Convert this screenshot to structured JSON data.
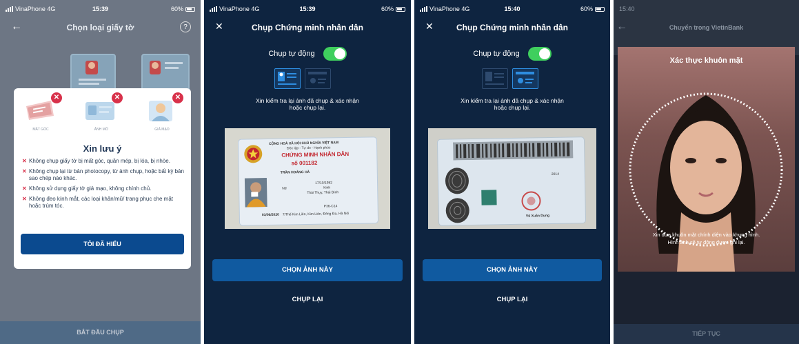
{
  "panel1": {
    "status": {
      "carrier": "VinaPhone",
      "network": "4G",
      "time": "15:39",
      "battery": "60%"
    },
    "nav": {
      "title": "Chọn loại giấy tờ",
      "back_icon": "back-arrow-icon",
      "help_icon": "help-icon"
    },
    "modal": {
      "warnings": [
        {
          "caption": "MẤT GÓC"
        },
        {
          "caption": "ẢNH MỜ"
        },
        {
          "caption": "GIẢ MẠO"
        }
      ],
      "title": "Xin lưu ý",
      "rules": [
        "Không chụp giấy tờ bị mất góc, quăn mép, bị lóa, bị nhòe.",
        "Không chụp lại từ bản photocopy, từ ảnh chụp, hoặc bất kỳ bản sao chép nào khác.",
        "Không sử dụng giấy tờ giả mạo, không chính chủ.",
        "Không đeo kính mắt, các loại khăn/mũ/ trang phục che mặt hoặc trùm tóc."
      ],
      "confirm_label": "TÔI ĐÃ HIỂU"
    },
    "start_label": "BẮT ĐẦU CHỤP"
  },
  "panel2": {
    "status": {
      "carrier": "VinaPhone",
      "network": "4G",
      "time": "15:39",
      "battery": "60%"
    },
    "nav": {
      "title": "Chụp Chứng minh nhân dân",
      "close_icon": "close-icon"
    },
    "auto_label": "Chụp tự động",
    "hint_line1": "Xin kiểm tra lại ảnh đã chụp & xác nhận",
    "hint_line2": "hoặc chụp lại.",
    "card": {
      "header1": "CỘNG HOÀ XÃ HỘI CHỦ NGHĨA VIỆT NAM",
      "header2": "Độc lập - Tự do - Hạnh phúc",
      "title": "CHỨNG MINH NHÂN DÂN",
      "number": "số 001182",
      "name": "TRẦN HOÀNG HÀ",
      "dob": "17/10/1982",
      "gender": "Nữ",
      "ethnic": "Kinh",
      "origin": "Thái Thụy, Thái Bình",
      "code": "P36-C14",
      "address": "7/Thế Kim Liên, Kim Liên, Đống Đa, Hà Nội",
      "issued": "03/06/2020"
    },
    "choose_label": "CHỌN ẢNH NÀY",
    "retake_label": "CHỤP LẠI"
  },
  "panel3": {
    "status": {
      "carrier": "VinaPhone",
      "network": "4G",
      "time": "15:40",
      "battery": "60%"
    },
    "nav": {
      "title": "Chụp Chứng minh nhân dân",
      "close_icon": "close-icon"
    },
    "auto_label": "Chụp tự động",
    "hint_line1": "Xin kiểm tra lại ảnh đã chụp & xác nhận",
    "hint_line2": "hoặc chụp lại.",
    "card": {
      "signer": "Vũ Xuân Dung",
      "year": "2014"
    },
    "choose_label": "CHỌN ẢNH NÀY",
    "retake_label": "CHỤP LẠI"
  },
  "panel4": {
    "status": {
      "time": "15:40"
    },
    "nav": {
      "title": "Chuyển trong VietinBank",
      "back_icon": "back-arrow-icon"
    },
    "title": "Xác thực khuôn mặt",
    "instruction_line1": "Xin đưa khuôn mặt chính diện vào khung hình.",
    "instruction_line2": "Hình ảnh sẽ tự động được ghi lại.",
    "continue_label": "TIẾP TỤC"
  },
  "colors": {
    "primary_blue": "#0b4a8f",
    "error_red": "#d8314a",
    "toggle_green": "#3fcf5e",
    "dark_navy": "#0e2440"
  }
}
